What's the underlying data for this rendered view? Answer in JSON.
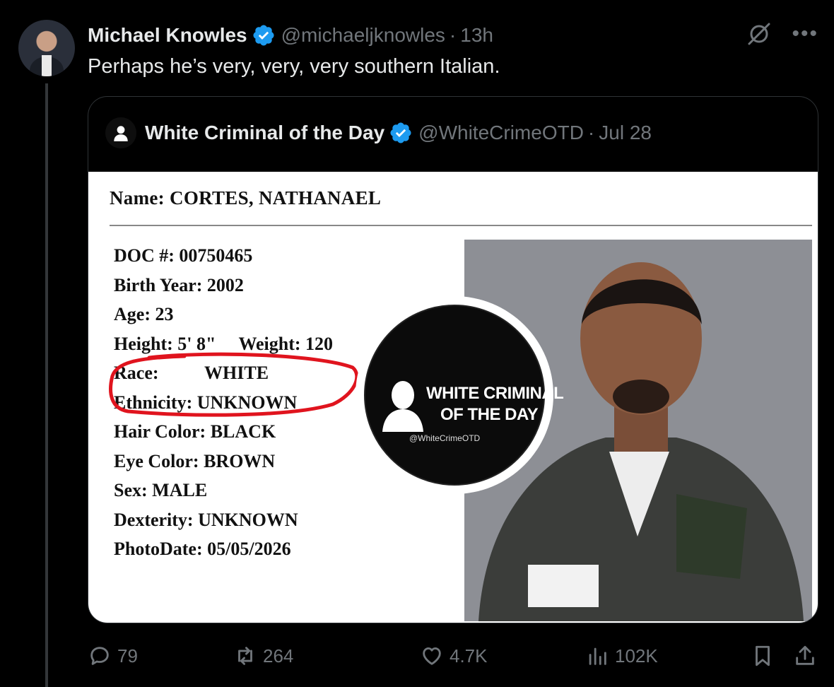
{
  "tweet": {
    "author_name": "Michael Knowles",
    "author_handle": "@michaeljknowles",
    "time": "13h",
    "text": "Perhaps he’s very, very, very southern Italian."
  },
  "quote": {
    "author_name": "White Criminal of the Day",
    "author_handle": "@WhiteCrimeOTD",
    "date": "Jul 28",
    "card": {
      "name_line": "Name: CORTES, NATHANAEL",
      "fields": [
        "DOC #: 00750465",
        "Birth Year: 2002",
        "Age: 23",
        "Height: 5' 8\"     Weight: 120",
        "Race:          WHITE",
        "Ethnicity: UNKNOWN",
        "Hair Color: BLACK",
        "Eye Color: BROWN",
        "Sex: MALE",
        "Dexterity: UNKNOWN",
        "PhotoDate: 05/05/2026"
      ],
      "logo": {
        "line1": "WHITE CRIMINAL",
        "line2": "OF THE DAY",
        "handle": "@WhiteCrimeOTD"
      }
    }
  },
  "actions": {
    "replies": "79",
    "reposts": "264",
    "likes": "4.7K",
    "views": "102K"
  },
  "colors": {
    "background": "#000000",
    "text": "#e7e9ea",
    "muted": "#71767b",
    "verified": "#1d9bf0",
    "annotation": "#e0141e"
  },
  "icons": [
    "verified-badge-icon",
    "grok-icon",
    "more-icon",
    "reply-icon",
    "repost-icon",
    "like-icon",
    "views-icon",
    "bookmark-icon",
    "share-icon"
  ]
}
